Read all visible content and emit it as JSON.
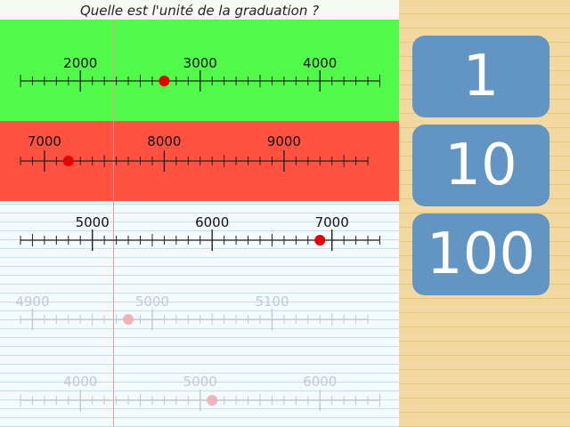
{
  "question": "Quelle est l'unité de la graduation ?",
  "answers": [
    {
      "label": "1"
    },
    {
      "label": "10"
    },
    {
      "label": "100"
    }
  ],
  "colors": {
    "correct_band": "#52fb4a",
    "wrong_band": "#ff5240",
    "answer_button": "#6295c2",
    "dot": "#e50000",
    "dot_faded": "#f0a8ae"
  },
  "number_lines": [
    {
      "state": "correct",
      "labels": [
        "2000",
        "3000",
        "4000"
      ],
      "start": 1500,
      "step": 100,
      "count": 31,
      "major_every": 10,
      "label_values": [
        2000,
        3000,
        4000
      ],
      "dot_value": 2700
    },
    {
      "state": "wrong",
      "labels": [
        "7000",
        "8000",
        "9000"
      ],
      "start": 6800,
      "step": 100,
      "count": 30,
      "major_every": 10,
      "label_values": [
        7000,
        8000,
        9000
      ],
      "dot_value": 7200
    },
    {
      "state": "current",
      "labels": [
        "5000",
        "6000",
        "7000"
      ],
      "start": 4400,
      "step": 100,
      "count": 31,
      "major_every": 10,
      "label_values": [
        5000,
        6000,
        7000
      ],
      "dot_value": 6900
    },
    {
      "state": "upcoming",
      "labels": [
        "4900",
        "5000",
        "5100"
      ],
      "start": 4890,
      "step": 10,
      "count": 30,
      "major_every": 10,
      "label_values": [
        4900,
        5000,
        5100
      ],
      "dot_value": 4980
    },
    {
      "state": "upcoming",
      "labels": [
        "4000",
        "5000",
        "6000"
      ],
      "start": 3500,
      "step": 100,
      "count": 31,
      "major_every": 10,
      "label_values": [
        4000,
        5000,
        6000
      ],
      "dot_value": 5100
    }
  ]
}
